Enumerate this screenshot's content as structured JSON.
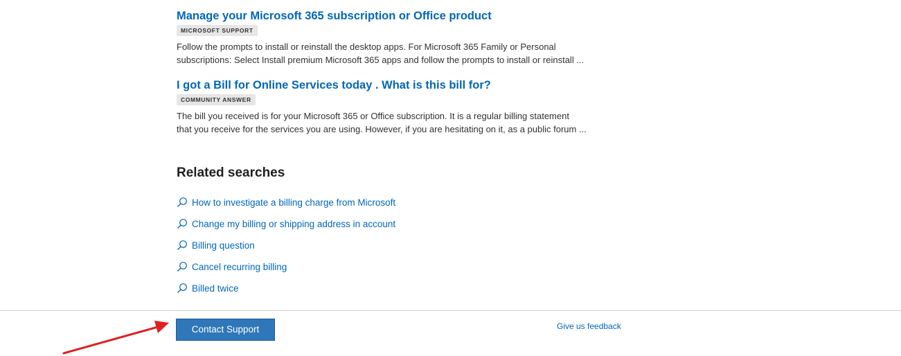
{
  "results": [
    {
      "title": "Manage your Microsoft 365 subscription or Office product",
      "badge": "MICROSOFT SUPPORT",
      "snippet_line1": "Follow the prompts to install or reinstall the desktop apps. For Microsoft 365 Family or Personal",
      "snippet_line2": "subscriptions: Select Install premium Microsoft 365 apps and follow the prompts to install or reinstall ..."
    },
    {
      "title": "I got a Bill for Online Services today . What is this bill for?",
      "badge": "COMMUNITY ANSWER",
      "snippet_line1": "The bill you received is for your Microsoft 365 or Office subscription. It is a regular billing statement",
      "snippet_line2": "that you receive for the services you are using. However, if you are hesitating on it, as a public forum ..."
    }
  ],
  "related": {
    "heading": "Related searches",
    "icon": "search-icon",
    "items": [
      "How to investigate a billing charge from Microsoft",
      "Change my billing or shipping address in account",
      "Billing question",
      "Cancel recurring billing",
      "Billed twice"
    ]
  },
  "footer": {
    "contact_button": "Contact Support",
    "feedback_link": "Give us feedback"
  },
  "colors": {
    "link": "#0067b8",
    "button": "#2f77b8",
    "annotation_arrow": "#e02020"
  }
}
